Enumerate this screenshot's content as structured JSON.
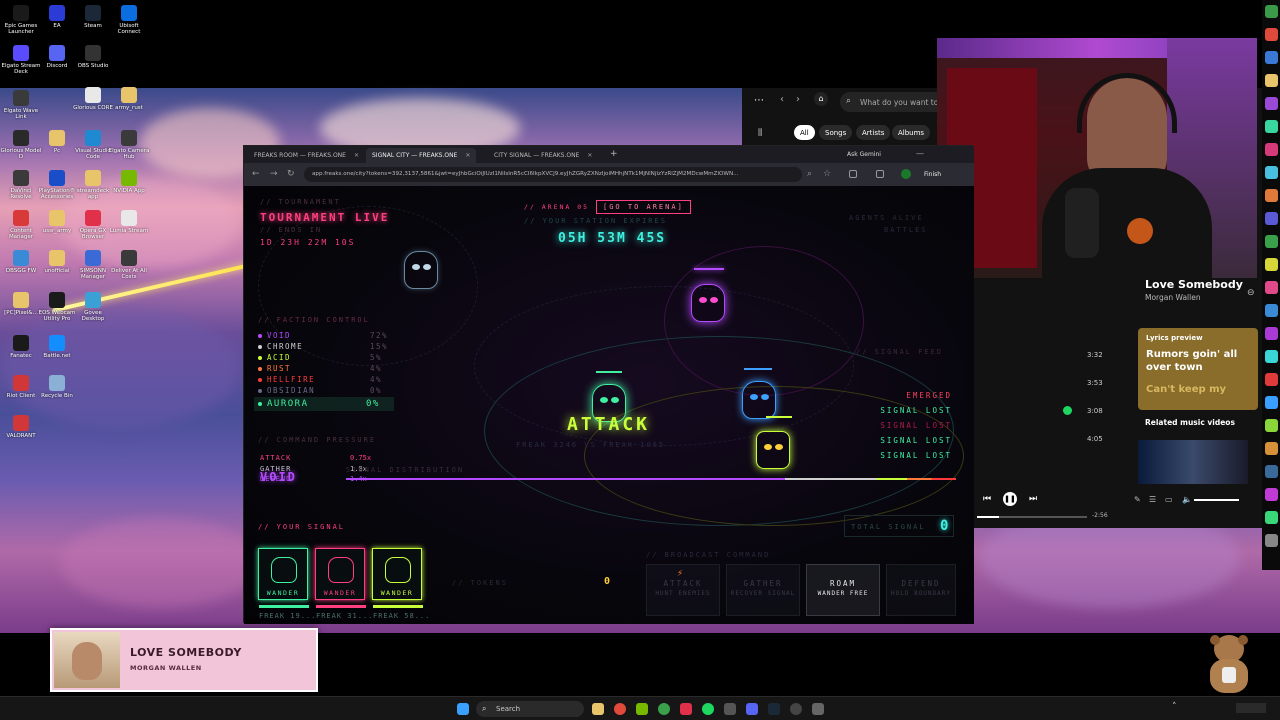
{
  "desktop": {
    "icons": [
      {
        "label": "Epic Games Launcher",
        "color": "#1a1a1a"
      },
      {
        "label": "EA",
        "color": "#2a3bd6"
      },
      {
        "label": "Steam",
        "color": "#1b2838"
      },
      {
        "label": "Ubisoft Connect",
        "color": "#0a6ee0"
      },
      {
        "label": "Elgato Stream Deck",
        "color": "#5a4bff"
      },
      {
        "label": "Discord",
        "color": "#5865f2"
      },
      {
        "label": "OBS Studio",
        "color": "#333"
      },
      {
        "label": "Elgato Wave Link",
        "color": "#3a3a3a"
      },
      {
        "label": "Glorious CORE",
        "color": "#e8e8e8"
      },
      {
        "label": "army_rust",
        "color": "#e8c46a"
      },
      {
        "label": "Glorious Model D",
        "color": "#2a2a2a"
      },
      {
        "label": "Pc",
        "color": "#e8c46a"
      },
      {
        "label": "Visual Studio Code",
        "color": "#1f8ad2"
      },
      {
        "label": "Elgato Camera Hub",
        "color": "#3a3a3a"
      },
      {
        "label": "DaVinci Resolve",
        "color": "#3a3a3a"
      },
      {
        "label": "PlayStation® Accessories",
        "color": "#1a4ec8"
      },
      {
        "label": "streamdeck app",
        "color": "#e8c46a"
      },
      {
        "label": "NVIDIA App",
        "color": "#76b900"
      },
      {
        "label": "Content Manager",
        "color": "#d83a3a"
      },
      {
        "label": "ussr_army",
        "color": "#e8c46a"
      },
      {
        "label": "Opera GX Browser",
        "color": "#e0304a"
      },
      {
        "label": "Lumia Stream",
        "color": "#e8e8e8"
      },
      {
        "label": "DBSGG FW",
        "color": "#3a8ad6"
      },
      {
        "label": "unofficial",
        "color": "#e8c46a"
      },
      {
        "label": "SIMSONN Manager",
        "color": "#3a6ad6"
      },
      {
        "label": "Deliver At All Costs",
        "color": "#3a3a3a"
      },
      {
        "label": "[PC]Pixel&...",
        "color": "#e8c46a"
      },
      {
        "label": "EOS Webcam Utility Pro",
        "color": "#1a1a1a"
      },
      {
        "label": "Govee Desktop",
        "color": "#3aa0d6"
      },
      {
        "label": "Fanatec",
        "color": "#1a1a1a"
      },
      {
        "label": "Battle.net",
        "color": "#148eff"
      },
      {
        "label": "Riot Client",
        "color": "#d13639"
      },
      {
        "label": "Recycle Bin",
        "color": "#8ab0d6"
      },
      {
        "label": "VALORANT",
        "color": "#d13639"
      }
    ]
  },
  "browser": {
    "tabs": [
      {
        "label": "FREAKS ROOM — FREAKS.ONE"
      },
      {
        "label": "SIGNAL CITY — FREAKS.ONE"
      },
      {
        "label": "CITY SIGNAL — FREAKS.ONE"
      }
    ],
    "new_tab": "+",
    "ask_gemini": "Ask Gemini",
    "url": "app.freaks.one/city?tokens=392,3137,5861&jwt=eyJhbGciOiJIUzI1NiIsInR5cCI6IkpXVCJ9.eyJhZGRyZXNzIjoiMHhjNTk1MjNlNjIzYzRlZjM2MDcwMmZlOWN...",
    "finish": "Finish"
  },
  "game": {
    "tournament_header": "// TOURNAMENT",
    "tournament": "TOURNAMENT LIVE",
    "ends_in": "// ENDS IN",
    "tournament_time": "1D 23H 22M 10S",
    "arena": "// ARENA 05",
    "go_arena": "[GO TO ARENA]",
    "your_station": "// YOUR STATION EXPIRES",
    "countdown": "05H 53M 45S",
    "agents_alive": "AGENTS ALIVE",
    "battles": "BATTLES",
    "faction_control": "// FACTION CONTROL",
    "factions": [
      {
        "name": "VOID",
        "pct": "72%",
        "color": "#b44bff"
      },
      {
        "name": "CHROME",
        "pct": "15%",
        "color": "#d0d0d0"
      },
      {
        "name": "ACID",
        "pct": "5%",
        "color": "#c8ff3a"
      },
      {
        "name": "RUST",
        "pct": "4%",
        "color": "#ff7a3a"
      },
      {
        "name": "HELLFIRE",
        "pct": "4%",
        "color": "#ff3a3a"
      },
      {
        "name": "OBSIDIAN",
        "pct": "0%",
        "color": "#6a6a8a"
      },
      {
        "name": "AURORA",
        "pct": "0%",
        "color": "#3ef0a0"
      }
    ],
    "command_pressure": "// COMMAND PRESSURE",
    "pressure": [
      {
        "name": "ATTACK",
        "value": "0.75x",
        "color": "#ff3f7f"
      },
      {
        "name": "GATHER",
        "value": "1.0x",
        "color": "#c8c8c8"
      },
      {
        "name": "DEFEND",
        "value": "1.4x",
        "color": "#b44bff"
      }
    ],
    "void_label": "VOID",
    "signal_distribution": "SIGNAL DISTRIBUTION",
    "attack": "ATTACK",
    "matchup": "FREAK 3246 VS FREAK 1065",
    "signal_feed": "// SIGNAL FEED",
    "feed": [
      {
        "text": "EMERGED",
        "color": "#ff3f5f"
      },
      {
        "text": "SIGNAL LOST",
        "color": "#3ef0a0"
      },
      {
        "text": "SIGNAL LOST",
        "color": "#b01a4a"
      },
      {
        "text": "SIGNAL LOST",
        "color": "#3ef0a0"
      },
      {
        "text": "SIGNAL LOST",
        "color": "#3ef0a0"
      }
    ],
    "your_signal": "// YOUR SIGNAL",
    "total_signal": "TOTAL SIGNAL",
    "total_value": "0",
    "cards": [
      {
        "label": "WANDER",
        "name": "FREAK 19...",
        "color": "#3ef0a0"
      },
      {
        "label": "WANDER",
        "name": "FREAK 31...",
        "color": "#ff3f7f"
      },
      {
        "label": "WANDER",
        "name": "FREAK 58...",
        "color": "#c8ff3a"
      }
    ],
    "tokens_label": "// TOKENS",
    "tokens_value": "0",
    "broadcast": "// BROADCAST COMMAND",
    "commands": [
      {
        "label": "ATTACK",
        "sub": "HUNT ENEMIES"
      },
      {
        "label": "GATHER",
        "sub": "RECOVER SIGNAL"
      },
      {
        "label": "ROAM",
        "sub": "WANDER FREE"
      },
      {
        "label": "DEFEND",
        "sub": "HOLD BOUNDARY"
      }
    ]
  },
  "spotify": {
    "search_placeholder": "What do you want to play?",
    "chips": [
      "All",
      "Songs",
      "Artists",
      "Albums"
    ],
    "durations": [
      "3:32",
      "3:53",
      "3:08",
      "4:05"
    ],
    "track": "Love Somebody",
    "artist": "Morgan Wallen",
    "lyrics_preview": "Lyrics preview",
    "lyrics_line1": "Rumors goin' all over town",
    "lyrics_line2": "Can't keep my",
    "related": "Related music videos",
    "remaining": "-2:56"
  },
  "overlay": {
    "title": "LOVE SOMEBODY",
    "artist": "MORGAN WALLEN"
  },
  "taskbar": {
    "search": "Search"
  }
}
